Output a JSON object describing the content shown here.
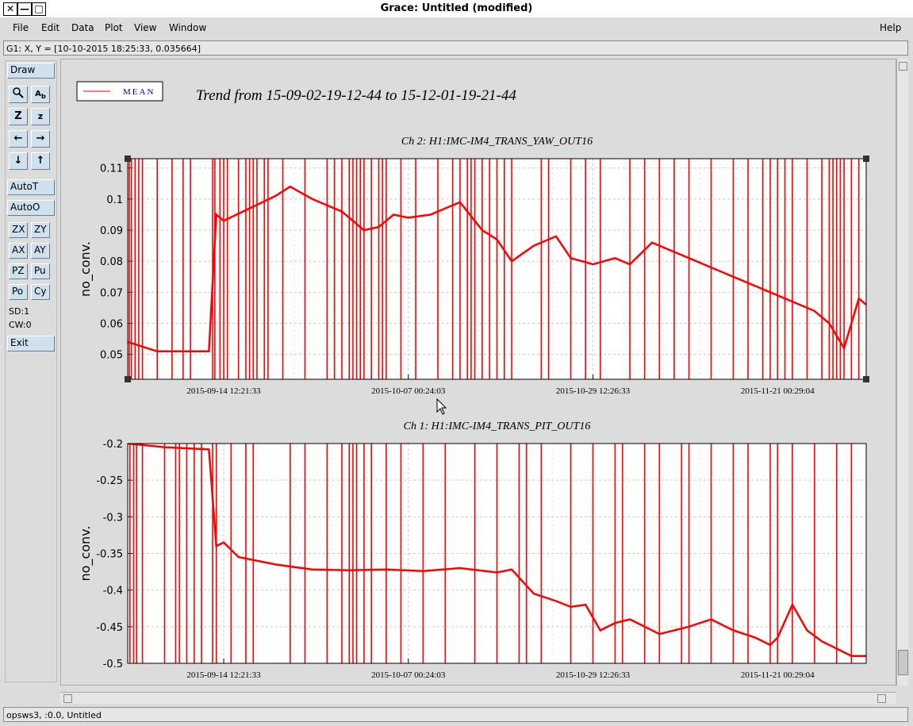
{
  "window": {
    "title": "Grace: Untitled (modified)",
    "controls": [
      "✕",
      "—",
      "□"
    ]
  },
  "menubar": {
    "items": [
      "File",
      "Edit",
      "Data",
      "Plot",
      "View",
      "Window"
    ],
    "help": "Help"
  },
  "locator": "G1: X, Y = [10-10-2015 18:25:33, 0.035664]",
  "toolbar": {
    "draw": "Draw",
    "autot": "AutoT",
    "autoo": "AutoO",
    "zx": "ZX",
    "zy": "ZY",
    "ax": "AX",
    "ay": "AY",
    "pz": "PZ",
    "pu": "Pu",
    "po": "Po",
    "cy": "Cy",
    "sd": "SD:1",
    "cw": "CW:0",
    "exit": "Exit"
  },
  "status": "opsws3, :0.0, Untitled",
  "legend": {
    "label": "MEAN",
    "color": "#ff0000"
  },
  "main_title": "Trend from 15-09-02-19-12-44 to 15-12-01-19-21-44",
  "chart_data": [
    {
      "type": "line",
      "title": "Ch 2: H1:IMC-IM4_TRANS_YAW_OUT16",
      "ylabel": "no_conv.",
      "ylim": [
        0.042,
        0.113
      ],
      "yticks": [
        "0.11",
        "0.1",
        "0.09",
        "0.08",
        "0.07",
        "0.06",
        "0.05"
      ],
      "ytick_values": [
        0.11,
        0.1,
        0.09,
        0.08,
        0.07,
        0.06,
        0.05
      ],
      "xticks": [
        "2015-09-14 12:21:33",
        "2015-10-07 00:24:03",
        "2015-10-29 12:26:33",
        "2015-11-21 00:29:04"
      ],
      "xlim": [
        0,
        1
      ],
      "grid": true,
      "series": [
        {
          "name": "MEAN",
          "color": "#ff0000",
          "x": [
            0,
            0.04,
            0.11,
            0.12,
            0.13,
            0.2,
            0.22,
            0.25,
            0.29,
            0.32,
            0.34,
            0.36,
            0.38,
            0.41,
            0.43,
            0.45,
            0.48,
            0.5,
            0.52,
            0.55,
            0.58,
            0.6,
            0.63,
            0.66,
            0.68,
            0.71,
            0.74,
            0.77,
            0.8,
            0.83,
            0.85,
            0.88,
            0.9,
            0.93,
            0.95,
            0.97,
            0.99,
            1
          ],
          "y": [
            0.054,
            0.051,
            0.051,
            0.095,
            0.093,
            0.101,
            0.104,
            0.1,
            0.096,
            0.09,
            0.091,
            0.095,
            0.094,
            0.095,
            0.097,
            0.099,
            0.09,
            0.087,
            0.08,
            0.085,
            0.088,
            0.081,
            0.079,
            0.081,
            0.079,
            0.086,
            0.083,
            0.08,
            0.077,
            0.074,
            0.072,
            0.069,
            0.067,
            0.064,
            0.06,
            0.052,
            0.068,
            0.066
          ]
        }
      ],
      "dropout_x": [
        0.002,
        0.005,
        0.01,
        0.015,
        0.02,
        0.04,
        0.06,
        0.075,
        0.085,
        0.115,
        0.118,
        0.125,
        0.13,
        0.135,
        0.15,
        0.16,
        0.165,
        0.17,
        0.175,
        0.185,
        0.19,
        0.21,
        0.24,
        0.27,
        0.28,
        0.29,
        0.3,
        0.305,
        0.31,
        0.315,
        0.32,
        0.33,
        0.34,
        0.345,
        0.35,
        0.37,
        0.39,
        0.42,
        0.44,
        0.45,
        0.46,
        0.465,
        0.47,
        0.48,
        0.49,
        0.5,
        0.51,
        0.52,
        0.56,
        0.57,
        0.6,
        0.62,
        0.64,
        0.68,
        0.7,
        0.72,
        0.74,
        0.76,
        0.79,
        0.82,
        0.84,
        0.86,
        0.87,
        0.88,
        0.89,
        0.9,
        0.92,
        0.94,
        0.95,
        0.955,
        0.96,
        0.965,
        0.97,
        0.98,
        0.99
      ]
    },
    {
      "type": "line",
      "title": "Ch 1: H1:IMC-IM4_TRANS_PIT_OUT16",
      "ylabel": "no_conv.",
      "ylim": [
        -0.5,
        -0.2
      ],
      "yticks": [
        "-0.2",
        "-0.25",
        "-0.3",
        "-0.35",
        "-0.4",
        "-0.45",
        "-0.5"
      ],
      "ytick_values": [
        -0.2,
        -0.25,
        -0.3,
        -0.35,
        -0.4,
        -0.45,
        -0.5
      ],
      "xticks": [
        "2015-09-14 12:21:33",
        "2015-10-07 00:24:03",
        "2015-10-29 12:26:33",
        "2015-11-21 00:29:04"
      ],
      "xlim": [
        0,
        1
      ],
      "grid": true,
      "series": [
        {
          "name": "MEAN",
          "color": "#ff0000",
          "x": [
            0,
            0.05,
            0.11,
            0.12,
            0.13,
            0.15,
            0.2,
            0.25,
            0.3,
            0.35,
            0.4,
            0.45,
            0.5,
            0.52,
            0.55,
            0.58,
            0.6,
            0.62,
            0.64,
            0.66,
            0.68,
            0.7,
            0.72,
            0.74,
            0.76,
            0.79,
            0.82,
            0.85,
            0.87,
            0.88,
            0.9,
            0.92,
            0.94,
            0.96,
            0.98,
            1
          ],
          "y": [
            -0.2,
            -0.205,
            -0.208,
            -0.34,
            -0.335,
            -0.355,
            -0.365,
            -0.372,
            -0.373,
            -0.372,
            -0.374,
            -0.37,
            -0.376,
            -0.372,
            -0.405,
            -0.415,
            -0.423,
            -0.42,
            -0.455,
            -0.445,
            -0.44,
            -0.45,
            -0.46,
            -0.455,
            -0.45,
            -0.44,
            -0.455,
            -0.465,
            -0.475,
            -0.465,
            -0.42,
            -0.455,
            -0.47,
            -0.48,
            -0.49,
            -0.49
          ]
        }
      ],
      "dropout_x": [
        0.003,
        0.008,
        0.012,
        0.02,
        0.05,
        0.065,
        0.07,
        0.08,
        0.09,
        0.1,
        0.115,
        0.12,
        0.14,
        0.16,
        0.17,
        0.22,
        0.24,
        0.27,
        0.29,
        0.3,
        0.305,
        0.31,
        0.32,
        0.33,
        0.35,
        0.37,
        0.4,
        0.43,
        0.47,
        0.5,
        0.53,
        0.54,
        0.56,
        0.6,
        0.63,
        0.66,
        0.67,
        0.7,
        0.72,
        0.75,
        0.76,
        0.79,
        0.82,
        0.84,
        0.87,
        0.88,
        0.9,
        0.93,
        0.96,
        0.98
      ]
    }
  ]
}
